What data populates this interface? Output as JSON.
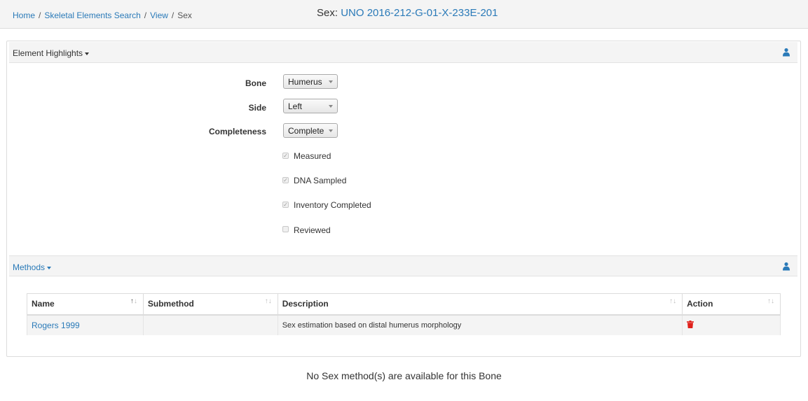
{
  "breadcrumb": {
    "home": "Home",
    "search": "Skeletal Elements Search",
    "view": "View",
    "current": "Sex",
    "separator": "/"
  },
  "title": {
    "label": "Sex:",
    "value": "UNO 2016-212-G-01-X-233E-201"
  },
  "highlights": {
    "heading": "Element Highlights",
    "fields": {
      "bone": {
        "label": "Bone",
        "value": "Humerus"
      },
      "side": {
        "label": "Side",
        "value": "Left"
      },
      "completeness": {
        "label": "Completeness",
        "value": "Complete"
      }
    },
    "checks": [
      {
        "label": "Measured",
        "checked": true
      },
      {
        "label": "DNA Sampled",
        "checked": true
      },
      {
        "label": "Inventory Completed",
        "checked": true
      },
      {
        "label": "Reviewed",
        "checked": false
      }
    ]
  },
  "methods": {
    "heading": "Methods",
    "columns": [
      "Name",
      "Submethod",
      "Description",
      "Action"
    ],
    "rows": [
      {
        "name": "Rogers 1999",
        "submethod": "",
        "description": "Sex estimation based on distal humerus morphology"
      }
    ]
  },
  "footer": {
    "message": "No Sex method(s) are available for this Bone"
  },
  "colors": {
    "link": "#2a7ab8",
    "delete": "#e0201a"
  },
  "icons": {
    "user": "user-icon",
    "trash": "trash-icon",
    "sort": "sort-icon",
    "caret": "caret-down-icon"
  }
}
